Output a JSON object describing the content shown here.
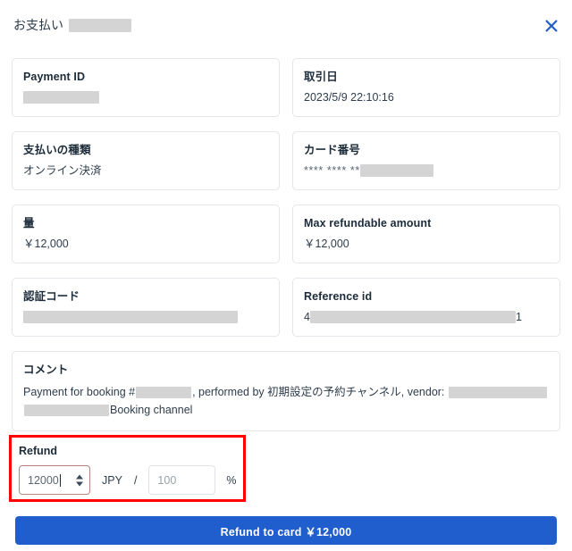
{
  "header": {
    "title": "お支払い",
    "title_redacted_width": 70,
    "close_icon": "close-icon"
  },
  "cards": [
    {
      "label": "Payment ID",
      "value": "",
      "redacted": true,
      "redact_width": 85
    },
    {
      "label": "取引日",
      "value": "2023/5/9 22:10:16",
      "redacted": false
    },
    {
      "label": "支払いの種類",
      "value": "オンライン決済",
      "redacted": false
    },
    {
      "label": "カード番号",
      "value": "**** **** **",
      "redacted": true,
      "redact_width": 82,
      "masked": true
    },
    {
      "label": "量",
      "value": "￥12,000",
      "redacted": false
    },
    {
      "label": "Max refundable amount",
      "value": "￥12,000",
      "redacted": false
    },
    {
      "label": "認証コード",
      "value": "",
      "redacted": true,
      "redact_width": 240
    },
    {
      "label": "Reference id",
      "value_prefix": "4",
      "value_suffix": "1",
      "redacted": true,
      "redact_width": 230
    }
  ],
  "comment": {
    "label": "コメント",
    "text_1": "Payment for booking #",
    "redact_1_width": 62,
    "text_2": ", performed by 初期設定の予約チャンネル, vendor:",
    "redact_2_width": 110,
    "redact_3_width": 95,
    "text_3": "Booking channel"
  },
  "refund": {
    "label": "Refund",
    "amount_value": "12000",
    "amount_placeholder": "12000",
    "currency": "JPY",
    "separator": "/",
    "percent_value": "100",
    "percent_placeholder": "100",
    "percent_sign": "%",
    "highlight_color": "#fe0000"
  },
  "submit": {
    "label": "Refund to card  ￥12,000",
    "color": "#1f5ecc"
  }
}
